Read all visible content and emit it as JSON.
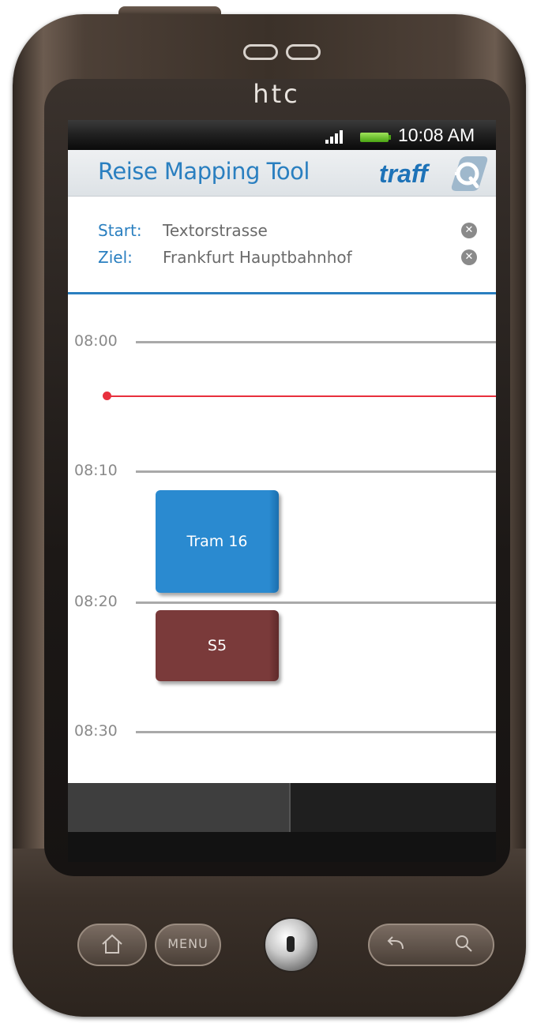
{
  "device": {
    "brand": "htc"
  },
  "status_bar": {
    "time": "10:08 AM",
    "signal_icon": "signal-bars-icon",
    "battery_icon": "battery-icon"
  },
  "app": {
    "title": "Reise Mapping Tool",
    "logo_text": "traff",
    "accent_color": "#2a7fc0",
    "route": {
      "start_label": "Start:",
      "start_value": "Textorstrasse",
      "dest_label": "Ziel:",
      "dest_value": "Frankfurt Hauptbahnhof"
    },
    "timeline": {
      "times": [
        "08:00",
        "08:10",
        "08:20",
        "08:30"
      ],
      "now_color": "#e8303d",
      "trips": [
        {
          "label": "Tram 16",
          "color": "#2a8ad0"
        },
        {
          "label": "S5",
          "color": "#7a3a3a"
        }
      ]
    }
  },
  "hardware_buttons": {
    "home_icon": "home-icon",
    "menu_label": "MENU",
    "back_icon": "back-icon",
    "search_icon": "search-icon"
  }
}
